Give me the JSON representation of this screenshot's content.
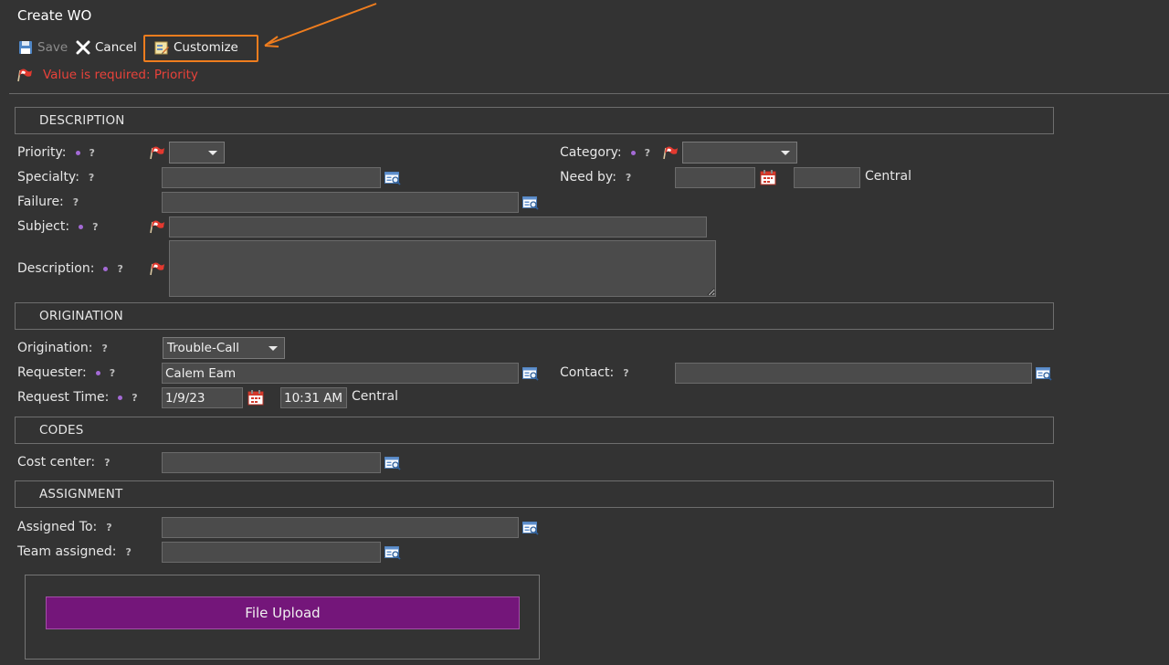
{
  "page": {
    "title": "Create WO"
  },
  "toolbar": {
    "save_label": "Save",
    "cancel_label": "Cancel",
    "customize_label": "Customize"
  },
  "error": {
    "message": "Value is required: Priority",
    "color": "#e8423a"
  },
  "sections": {
    "description": "DESCRIPTION",
    "origination": "ORIGINATION",
    "codes": "CODES",
    "assignment": "ASSIGNMENT"
  },
  "labels": {
    "priority": "Priority:",
    "specialty": "Specialty:",
    "failure": "Failure:",
    "subject": "Subject:",
    "description": "Description:",
    "category": "Category:",
    "need_by": "Need by:",
    "origination": "Origination:",
    "requester": "Requester:",
    "request_time": "Request Time:",
    "contact": "Contact:",
    "cost_center": "Cost center:",
    "assigned_to": "Assigned To:",
    "team_assigned": "Team assigned:"
  },
  "help_glyph": "?",
  "values": {
    "priority": "",
    "category": "",
    "specialty": "",
    "failure": "",
    "subject": "",
    "description": "",
    "need_by_date": "",
    "need_by_time": "",
    "need_by_timezone": "Central",
    "origination": "Trouble-Call",
    "requester": "Calem Eam",
    "contact": "",
    "request_date": "1/9/23",
    "request_time": "10:31 AM",
    "request_timezone": "Central",
    "cost_center": "",
    "assigned_to": "",
    "team_assigned": ""
  },
  "upload": {
    "label": "File Upload"
  },
  "colors": {
    "background": "#333333",
    "accent_purple": "#74167a",
    "required_dot": "#a46ad6",
    "annotation_orange": "#ef7d1e"
  },
  "icons": [
    "save-icon",
    "cancel-icon",
    "customize-icon",
    "required-flag-icon",
    "lookup-icon",
    "calendar-icon",
    "annotation-arrow"
  ]
}
